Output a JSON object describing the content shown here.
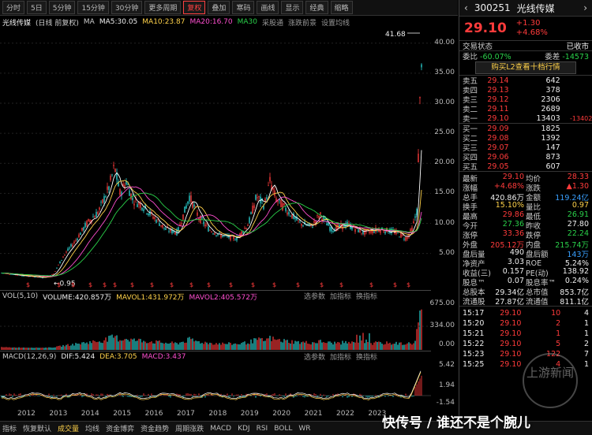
{
  "toolbar": {
    "items": [
      "分时",
      "5日",
      "5分钟",
      "15分钟",
      "30分钟",
      "更多周期",
      "复权",
      "叠加",
      "寒码",
      "画线",
      "显示",
      "经典",
      "缩略"
    ],
    "active": "复权"
  },
  "legend": {
    "name": "光线传媒",
    "mode": "(日线 前复权)",
    "ma": "MA",
    "ma5": "MA5:30.05",
    "ma10": "MA10:23.87",
    "ma20": "MA20:16.70",
    "ma30": "MA30",
    "tools": [
      "采股通",
      "涨跌前景",
      "设置均线"
    ]
  },
  "price_axis": {
    "ticks": [
      "40.00",
      "35.00",
      "30.00",
      "25.00",
      "20.00",
      "15.00",
      "10.00",
      "5.00"
    ],
    "high_label": "41.68",
    "low_label": "0.95"
  },
  "vol": {
    "title": "VOL(5,10)",
    "volume": "VOLUME:420.857万",
    "mavol1": "MAVOL1:431.972万",
    "mavol2": "MAVOL2:405.572万",
    "ticks": [
      "675.00",
      "334.00",
      "0.00"
    ],
    "buttons": [
      "选参数",
      "加指标",
      "换指标"
    ]
  },
  "macd": {
    "title": "MACD(12,26,9)",
    "dif": "DIF:5.424",
    "dea": "DEA:3.705",
    "macd": "MACD:3.437",
    "ticks": [
      "5.42",
      "1.94",
      "-1.54"
    ],
    "buttons": [
      "选参数",
      "加指标",
      "换指标"
    ]
  },
  "years": [
    "2012",
    "2013",
    "2014",
    "2015",
    "2016",
    "2017",
    "2018",
    "2019",
    "2020",
    "2021",
    "2022",
    "2023"
  ],
  "bottom_tabs": [
    "指标",
    "恢复默认",
    "成交量",
    "均线",
    "资金博弈",
    "资金趋势",
    "周期涨跌",
    "MACD",
    "KDJ",
    "RSI",
    "BOLL",
    "WR"
  ],
  "stock": {
    "code": "300251",
    "name": "光线传媒",
    "price": "29.10",
    "change": "+1.30",
    "pct": "+4.68%",
    "status_label": "交易状态",
    "status": "已收市"
  },
  "ratio": {
    "wb_label": "委比",
    "wb": "-60.07%",
    "wc_label": "委差",
    "wc": "-14573"
  },
  "l2_button": "购买L2查看十档行情",
  "asks": [
    {
      "label": "卖五",
      "price": "29.14",
      "vol": "642"
    },
    {
      "label": "卖四",
      "price": "29.13",
      "vol": "378"
    },
    {
      "label": "卖三",
      "price": "29.12",
      "vol": "2306"
    },
    {
      "label": "卖二",
      "price": "29.11",
      "vol": "2689"
    },
    {
      "label": "卖一",
      "price": "29.10",
      "vol": "13403",
      "extra": "-13402"
    }
  ],
  "bids": [
    {
      "label": "买一",
      "price": "29.09",
      "vol": "1825"
    },
    {
      "label": "买二",
      "price": "29.08",
      "vol": "1392"
    },
    {
      "label": "买三",
      "price": "29.07",
      "vol": "147"
    },
    {
      "label": "买四",
      "price": "29.06",
      "vol": "873"
    },
    {
      "label": "买五",
      "price": "29.05",
      "vol": "607"
    }
  ],
  "quote": [
    {
      "l1": "最新",
      "v1": "29.10",
      "c1": "red",
      "l2": "均价",
      "v2": "28.33",
      "c2": "red"
    },
    {
      "l1": "涨幅",
      "v1": "+4.68%",
      "c1": "red",
      "l2": "涨跌",
      "v2": "▲1.30",
      "c2": "red"
    },
    {
      "l1": "总手",
      "v1": "420.86万",
      "c1": "white",
      "l2": "金额",
      "v2": "119.24亿",
      "c2": "blue"
    },
    {
      "l1": "换手",
      "v1": "15.10%",
      "c1": "yellow",
      "l2": "量比",
      "v2": "0.97",
      "c2": "yellow"
    },
    {
      "l1": "最高",
      "v1": "29.86",
      "c1": "red",
      "l2": "最低",
      "v2": "26.91",
      "c2": "green"
    },
    {
      "l1": "今开",
      "v1": "27.36",
      "c1": "green",
      "l2": "昨收",
      "v2": "27.80",
      "c2": "white"
    },
    {
      "l1": "涨停",
      "v1": "33.36",
      "c1": "red",
      "l2": "跌停",
      "v2": "22.24",
      "c2": "green"
    },
    {
      "l1": "外盘",
      "v1": "205.12万",
      "c1": "red",
      "l2": "内盘",
      "v2": "215.74万",
      "c2": "green"
    },
    {
      "l1": "盘后量",
      "v1": "490",
      "c1": "white",
      "l2": "盘后额",
      "v2": "143万",
      "c2": "blue"
    },
    {
      "l1": "净资产",
      "v1": "3.03",
      "c1": "white",
      "l2": "ROE",
      "v2": "5.24%",
      "c2": "white"
    },
    {
      "l1": "收益(三)",
      "v1": "0.157",
      "c1": "white",
      "l2": "PE(动)",
      "v2": "138.92",
      "c2": "white"
    },
    {
      "l1": "股息™",
      "v1": "0.07",
      "c1": "white",
      "l2": "股息率™",
      "v2": "0.24%",
      "c2": "white"
    },
    {
      "l1": "总股本",
      "v1": "29.34亿",
      "c1": "white",
      "l2": "总市值",
      "v2": "853.7亿",
      "c2": "white"
    },
    {
      "l1": "流通股",
      "v1": "27.87亿",
      "c1": "white",
      "l2": "流通值",
      "v2": "811.1亿",
      "c2": "white"
    }
  ],
  "ticks_list": [
    {
      "time": "15:17",
      "price": "29.10",
      "vol": "10",
      "n": "4"
    },
    {
      "time": "15:20",
      "price": "29.10",
      "vol": "2",
      "n": "1"
    },
    {
      "time": "15:21",
      "price": "29.10",
      "vol": "1",
      "n": "1"
    },
    {
      "time": "15:22",
      "price": "29.10",
      "vol": "5",
      "n": "2"
    },
    {
      "time": "15:23",
      "price": "29.10",
      "vol": "122",
      "n": "7"
    },
    {
      "time": "15:25",
      "price": "29.10",
      "vol": "4",
      "n": "1"
    }
  ],
  "watermark": "快传号 / 谁还不是个腕儿",
  "badge": "上游新闻"
}
